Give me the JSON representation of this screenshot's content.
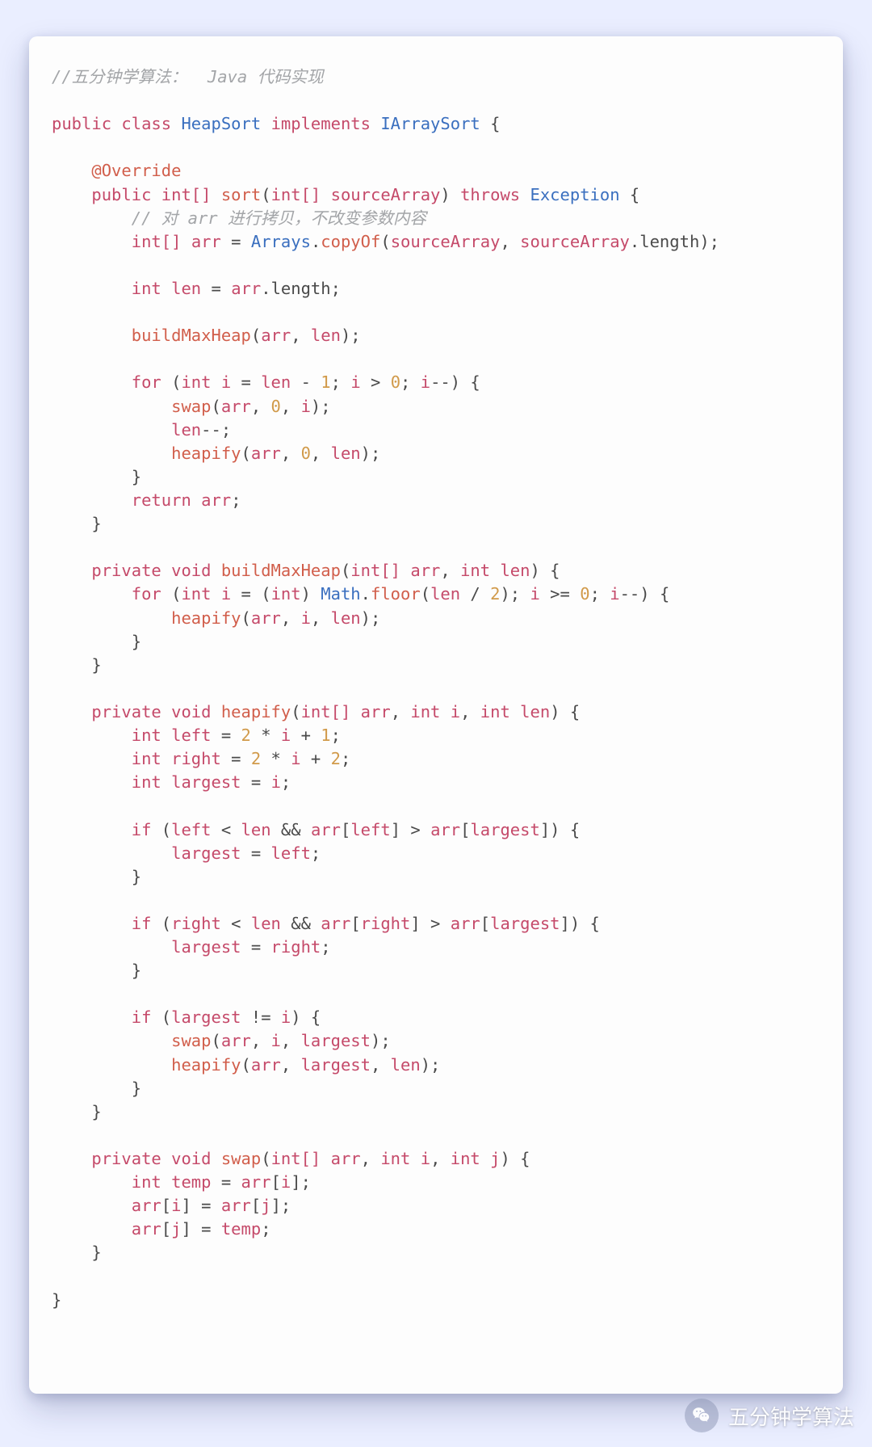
{
  "code": {
    "topComment": "//五分钟学算法：  Java 代码实现",
    "kw_public": "public",
    "kw_class": "class",
    "kw_implements": "implements",
    "kw_private": "private",
    "kw_void": "void",
    "kw_int": "int",
    "kw_int_arr": "int[]",
    "kw_for": "for",
    "kw_if": "if",
    "kw_return": "return",
    "kw_throws": "throws",
    "cls_HeapSort": "HeapSort",
    "cls_IArraySort": "IArraySort",
    "cls_Arrays": "Arrays",
    "cls_Math": "Math",
    "cls_Exception": "Exception",
    "an_Override": "@Override",
    "fn_sort": "sort",
    "fn_copyOf": "copyOf",
    "fn_buildMaxHeap": "buildMaxHeap",
    "fn_swap": "swap",
    "fn_heapify": "heapify",
    "fn_floor": "floor",
    "var_sourceArray": "sourceArray",
    "var_arr": "arr",
    "var_len": "len",
    "var_i": "i",
    "var_j": "j",
    "var_left": "left",
    "var_right": "right",
    "var_largest": "largest",
    "var_temp": "temp",
    "id_length": "length",
    "cm_copy": "// 对 arr 进行拷贝，不改变参数内容",
    "num_0": "0",
    "num_1": "1",
    "num_2": "2"
  },
  "watermark": {
    "text": "五分钟学算法"
  }
}
